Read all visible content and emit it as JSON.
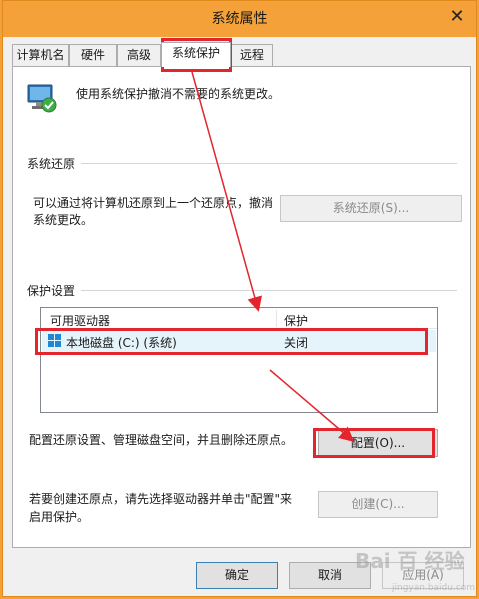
{
  "window": {
    "title": "系统属性",
    "close_glyph": "✕"
  },
  "tabs": [
    {
      "label": "计算机名"
    },
    {
      "label": "硬件"
    },
    {
      "label": "高级"
    },
    {
      "label": "系统保护"
    },
    {
      "label": "远程"
    }
  ],
  "header": {
    "description": "使用系统保护撤消不需要的系统更改。",
    "icon": "system-protection-icon"
  },
  "system_restore": {
    "group_label": "系统还原",
    "text_line1": "可以通过将计算机还原到上一个还原点，撤消",
    "text_line2": "系统更改。",
    "button_label": "系统还原(S)..."
  },
  "protection_settings": {
    "group_label": "保护设置",
    "columns": [
      "可用驱动器",
      "保护"
    ],
    "rows": [
      {
        "drive": "本地磁盘 (C:) (系统)",
        "protection": "关闭",
        "icon": "drive-icon"
      }
    ],
    "configure_text": "配置还原设置、管理磁盘空间，并且删除还原点。",
    "configure_button": "配置(O)...",
    "create_text_line1": "若要创建还原点，请先选择驱动器并单击\"配置\"来",
    "create_text_line2": "启用保护。",
    "create_button": "创建(C)..."
  },
  "footer": {
    "ok": "确定",
    "cancel": "取消",
    "apply": "应用(A)"
  },
  "watermark": {
    "text": "Bai 百 经验",
    "url": "jingyan.baidu.com"
  },
  "colors": {
    "titlebar": "#f4a13a",
    "annotation_red": "#e3262e",
    "selected_row": "#e5f3fb"
  }
}
